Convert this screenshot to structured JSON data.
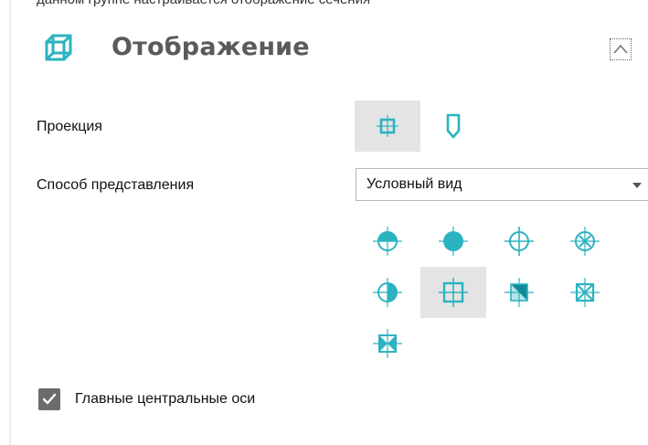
{
  "top_partial_text": "данном группе настраивается отображение сечения",
  "panel": {
    "title": "Отображение",
    "title_icon": "wireframe-cube-icon",
    "collapse_icon": "chevron-up-icon"
  },
  "projection": {
    "label": "Проекция",
    "options": [
      {
        "icon": "projection-front-icon",
        "selected": true
      },
      {
        "icon": "projection-side-icon",
        "selected": false
      }
    ]
  },
  "representation": {
    "label": "Способ представления",
    "selected_value": "Условный вид",
    "dropdown_icon": "dropdown-arrow-icon"
  },
  "modes": [
    {
      "icon": "half-filled-circle-top-icon",
      "selected": false
    },
    {
      "icon": "filled-circle-icon",
      "selected": false
    },
    {
      "icon": "circle-cross-icon",
      "selected": false
    },
    {
      "icon": "circle-x-icon",
      "selected": false
    },
    {
      "icon": "half-filled-circle-right-icon",
      "selected": false
    },
    {
      "icon": "square-cross-icon",
      "selected": true
    },
    {
      "icon": "square-half-diagonal-icon",
      "selected": false
    },
    {
      "icon": "square-x-icon",
      "selected": false
    },
    {
      "icon": "square-bowtie-icon",
      "selected": false
    }
  ],
  "main_axes": {
    "label": "Главные центральные оси",
    "checked": true
  },
  "colors": {
    "accent": "#2bb3c0",
    "accent_fill": "#5fc9d3",
    "title_text": "#5a5a5a",
    "checkbox": "#6b6b6b",
    "selected_bg": "#e4e4e4"
  }
}
